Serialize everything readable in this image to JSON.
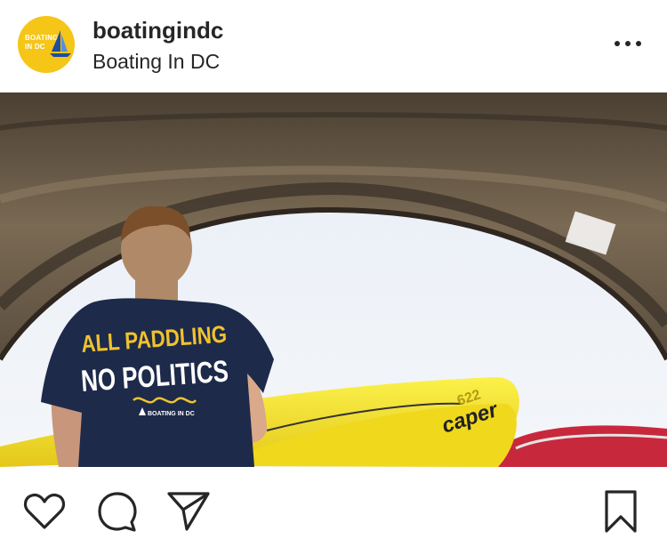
{
  "post": {
    "username": "boatingindc",
    "subtitle": "Boating In DC",
    "avatar_logo": "BOATING IN DC",
    "photo": {
      "shirt_line1": "ALL PADDLING",
      "shirt_line2": "NO POLITICS",
      "shirt_brand": "BOATING IN DC",
      "kayak_brand": "caper",
      "kayak_number": "622"
    }
  },
  "icons": {
    "more": "more-horizontal-icon",
    "like": "heart-icon",
    "comment": "comment-bubble-icon",
    "share": "paper-plane-icon",
    "save": "bookmark-icon"
  },
  "colors": {
    "brand_yellow": "#f5c518",
    "text": "#262626",
    "shirt_navy": "#1d2a4a",
    "kayak_yellow": "#f3e01a"
  }
}
